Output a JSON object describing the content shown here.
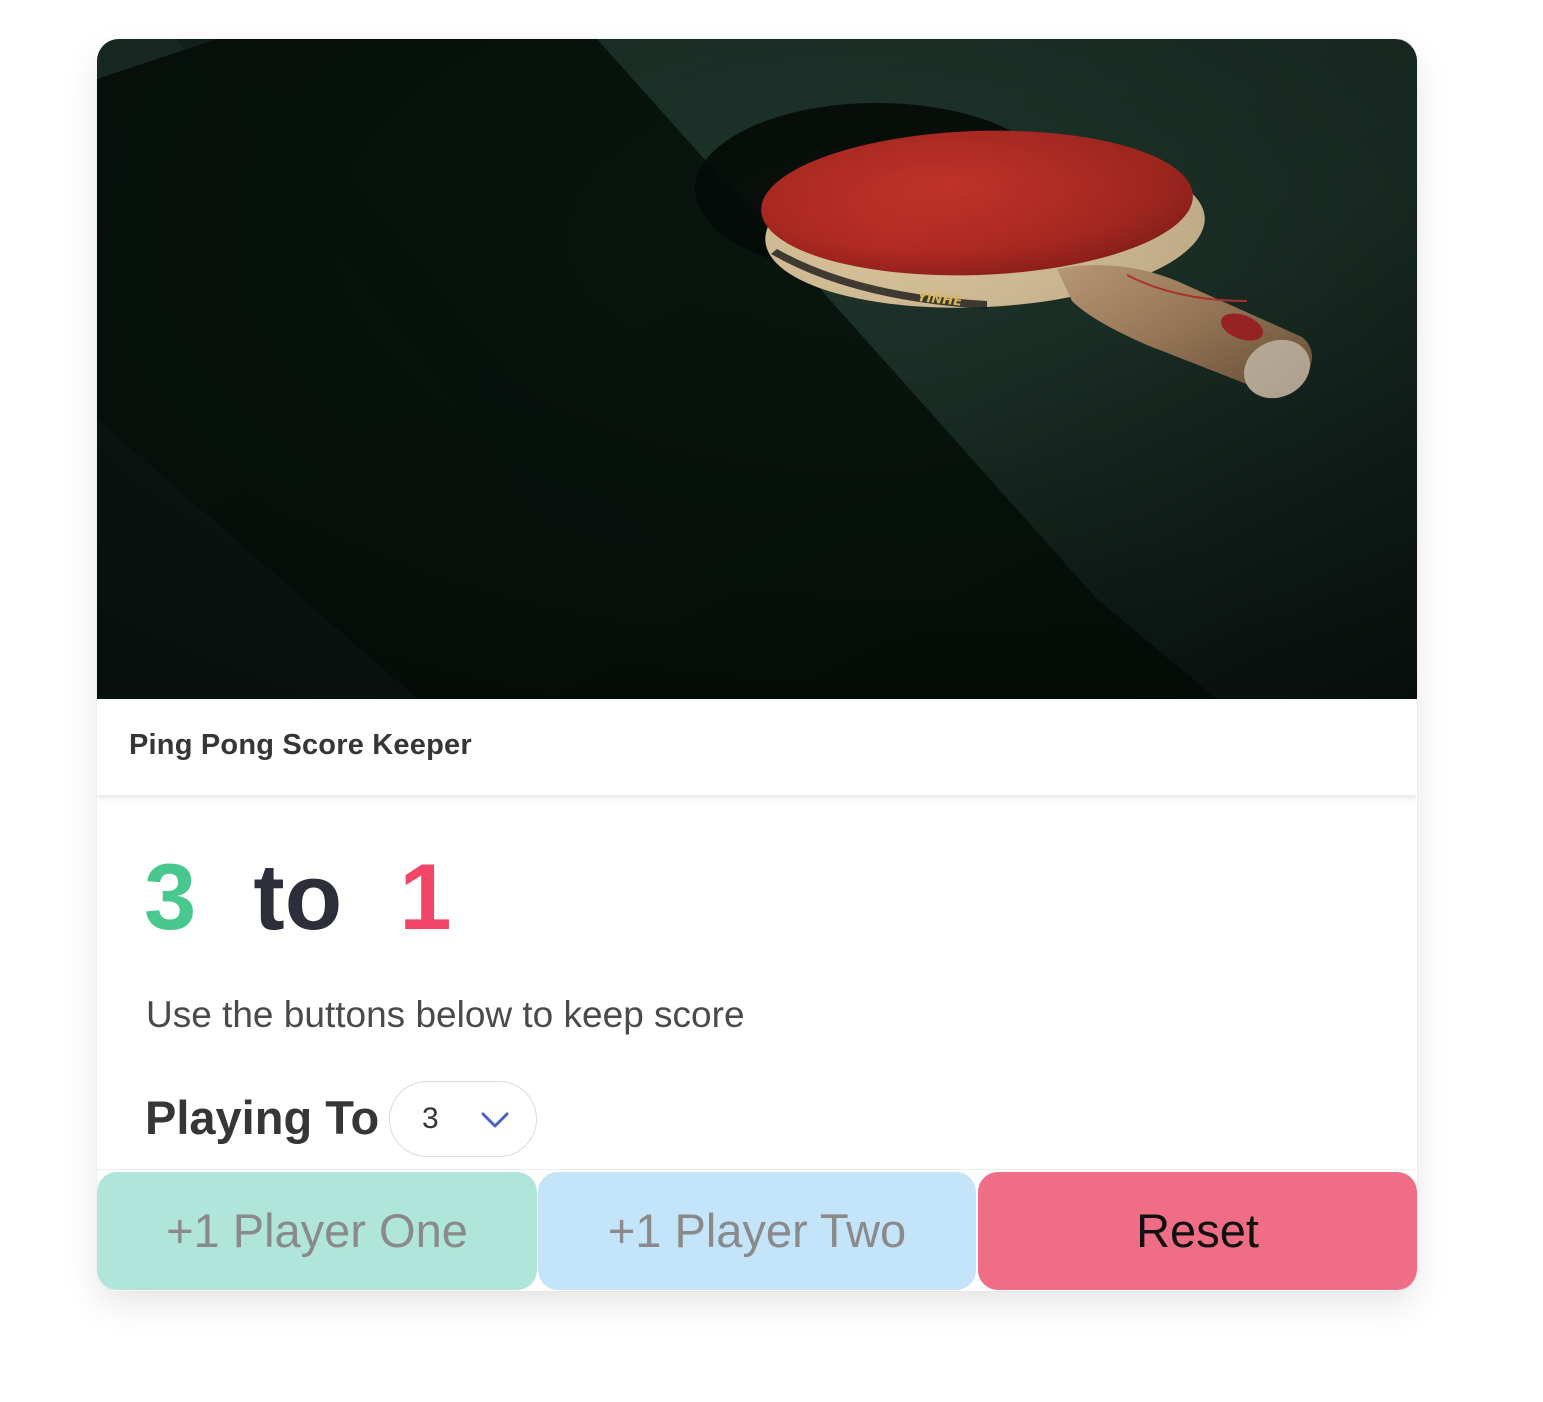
{
  "card": {
    "title": "Ping Pong Score Keeper",
    "image_description_icon": "ping-pong-paddle-photo"
  },
  "score": {
    "player_one": "3",
    "separator": "to",
    "player_two": "1",
    "player_one_color": "#48c78e",
    "player_two_color": "#f14668"
  },
  "subtitle": "Use the buttons below to keep score",
  "playing_to": {
    "label": "Playing To",
    "selected_value": "3",
    "icon": "chevron-down-icon"
  },
  "buttons": {
    "player_one": "+1 Player One",
    "player_two": "+1 Player Two",
    "reset": "Reset"
  },
  "colors": {
    "player_one_button": "#b0e6d9",
    "player_two_button": "#c4e4fa",
    "reset_button": "#ef6e85",
    "chevron": "#485fc7"
  }
}
